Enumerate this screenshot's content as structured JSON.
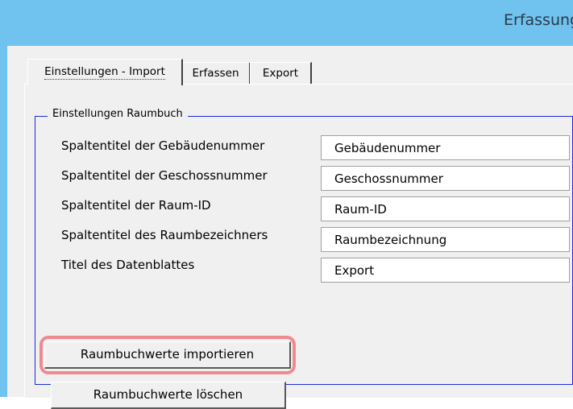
{
  "window": {
    "title": "Erfassung"
  },
  "tabs": [
    {
      "label": "Einstellungen - Import",
      "active": true
    },
    {
      "label": "Erfassen",
      "active": false
    },
    {
      "label": "Export",
      "active": false
    }
  ],
  "settings": {
    "caption": "Einstellungen Raumbuch",
    "rows": [
      {
        "label": "Spaltentitel der Gebäudenummer",
        "value": "Gebäudenummer"
      },
      {
        "label": "Spaltentitel der Geschossnummer",
        "value": "Geschossnummer"
      },
      {
        "label": "Spaltentitel der Raum-ID",
        "value": "Raum-ID"
      },
      {
        "label": "Spaltentitel des Raumbezeichners",
        "value": "Raumbezeichnung"
      },
      {
        "label": "Titel des Datenblattes",
        "value": "Export"
      }
    ]
  },
  "buttons": {
    "import_label": "Raumbuchwerte importieren",
    "delete_label": "Raumbuchwerte löschen"
  },
  "colors": {
    "titlebar": "#6fc3ee",
    "frame_border": "#1a2bd8",
    "highlight": "#f08a8f"
  }
}
